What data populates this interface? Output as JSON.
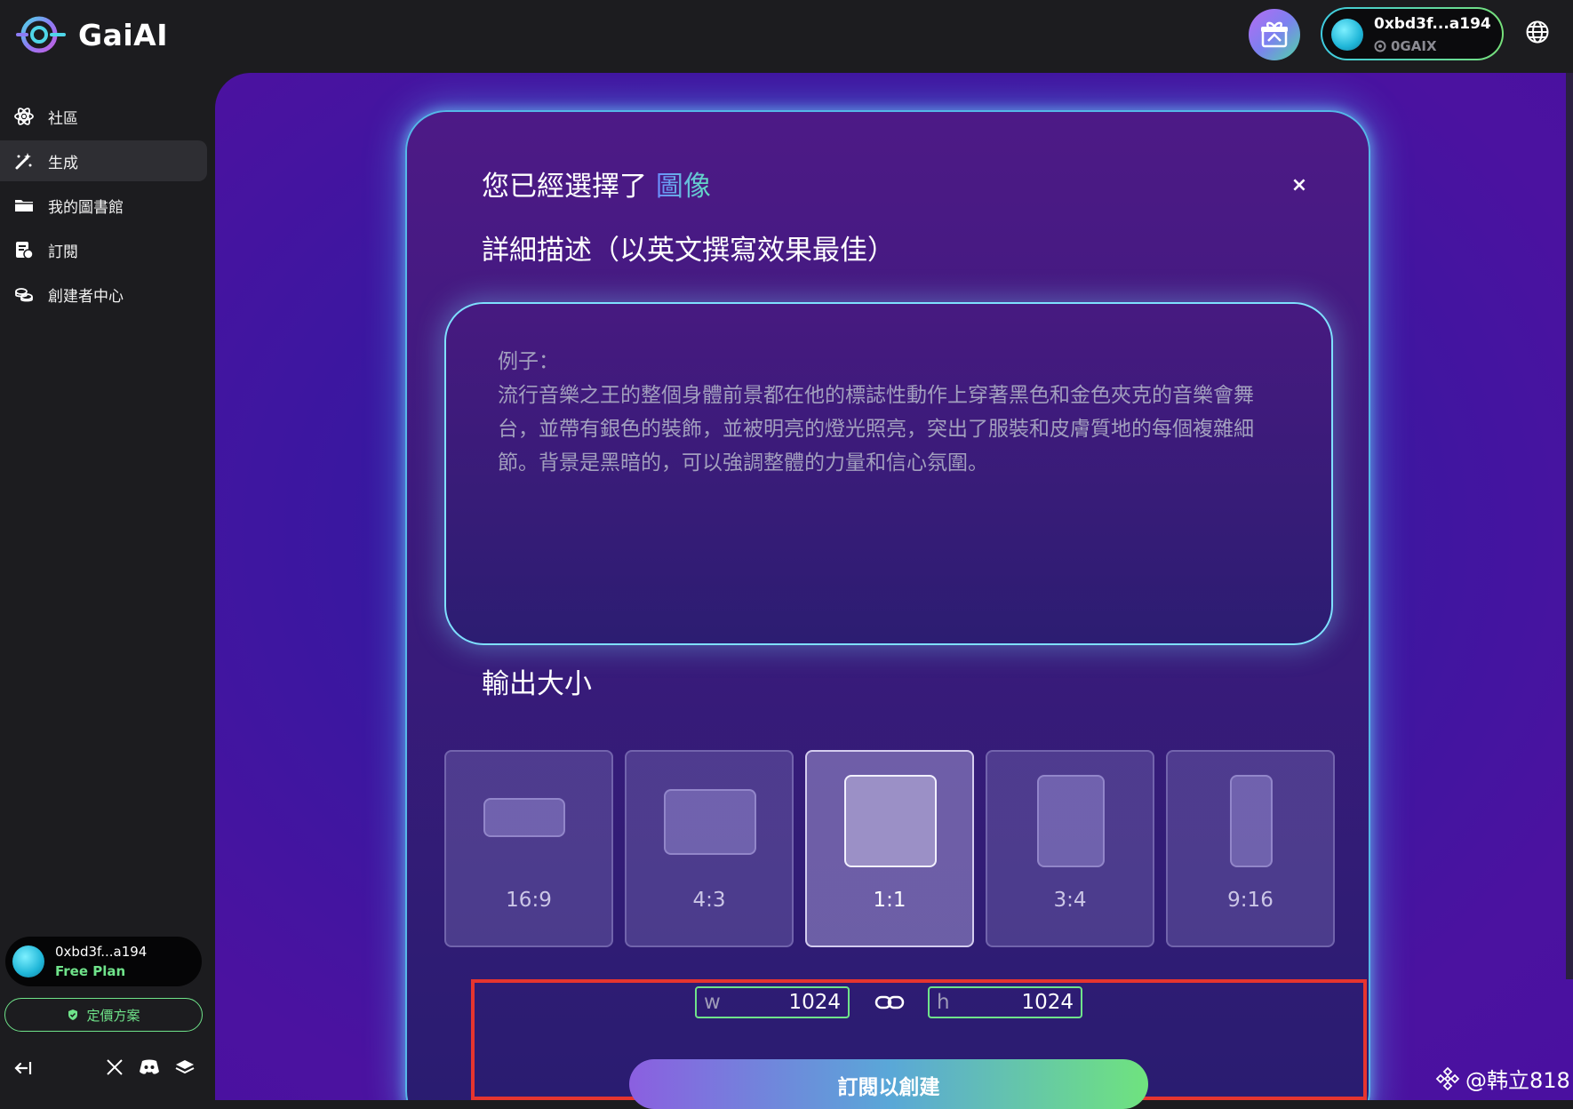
{
  "app": {
    "name": "GaiAI"
  },
  "header": {
    "wallet": {
      "address": "0xbd3f...a194",
      "token": "0GAIX"
    }
  },
  "sidebar": {
    "items": [
      {
        "label": "社區",
        "icon": "atom-icon"
      },
      {
        "label": "生成",
        "icon": "magic-wand-icon",
        "active": true
      },
      {
        "label": "我的圖書館",
        "icon": "folder-icon"
      },
      {
        "label": "訂閱",
        "icon": "subscription-icon"
      },
      {
        "label": "創建者中心",
        "icon": "coins-icon"
      }
    ],
    "user": {
      "address": "0xbd3f...a194",
      "plan": "Free Plan"
    },
    "pricing_label": "定價方案"
  },
  "dialog": {
    "title_prefix": "您已經選擇了",
    "title_highlight": "圖像",
    "close": "×",
    "prompt_heading": "詳細描述（以英文撰寫效果最佳）",
    "prompt_placeholder_label": "例子：",
    "prompt_placeholder_body": "流行音樂之王的整個身體前景都在他的標誌性動作上穿著黑色和金色夾克的音樂會舞台，並帶有銀色的裝飾，並被明亮的燈光照亮，突出了服裝和皮膚質地的每個複雜細節。背景是黑暗的，可以強調整體的力量和信心氛圍。",
    "output_heading": "輸出大小",
    "sizes": [
      {
        "label": "16:9"
      },
      {
        "label": "4:3"
      },
      {
        "label": "1:1",
        "selected": true
      },
      {
        "label": "3:4"
      },
      {
        "label": "9:16"
      }
    ],
    "width": {
      "prefix": "w",
      "value": "1024"
    },
    "height": {
      "prefix": "h",
      "value": "1024"
    },
    "create_label": "訂閱以創建"
  },
  "watermark": "@韩立818",
  "colors": {
    "accent_green": "#6fe38a",
    "accent_cyan": "#55b7e8",
    "highlight_red": "#e6352f",
    "background": "#1c1c1f"
  }
}
